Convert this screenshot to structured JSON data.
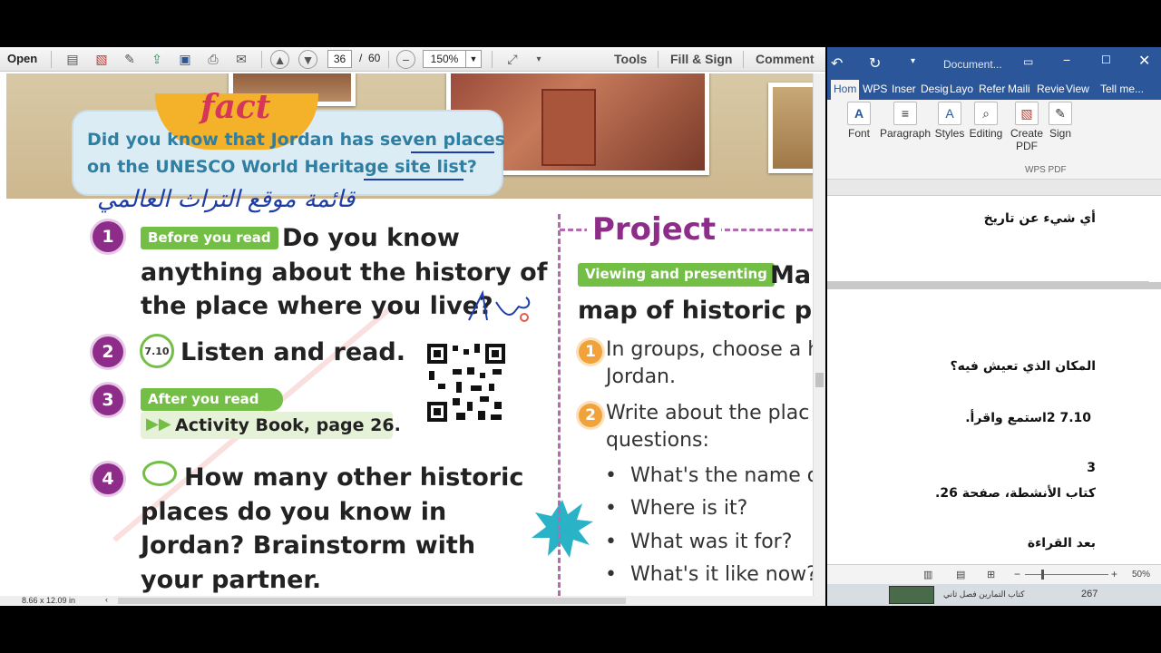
{
  "pdf_viewer": {
    "toolbar": {
      "open_label": "Open",
      "page_current": "36",
      "page_separator": "/",
      "page_total": "60",
      "zoom": "150%",
      "tools_label": "Tools",
      "fill_sign_label": "Fill & Sign",
      "comment_label": "Comment"
    },
    "status": {
      "page_size": "8.66 x 12.09 in"
    },
    "document": {
      "fact_badge": "fact",
      "fact_line1": "Did you know that Jordan has seven places",
      "fact_line2": "on the UNESCO World Heritage site list?",
      "handwriting_arabic": "قائمة موقع التراث العالمي",
      "items": [
        {
          "num": "1",
          "tag": "Before you read",
          "lines": [
            "Do you know",
            "anything about the history of",
            "the place where you live?"
          ]
        },
        {
          "num": "2",
          "audio_code": "7.10",
          "text": "Listen and read."
        },
        {
          "num": "3",
          "tag": "After you read",
          "sub": "Activity Book, page 26."
        },
        {
          "num": "4",
          "lines": [
            "How many other historic",
            "places do you know in",
            "Jordan? Brainstorm with",
            "your partner."
          ]
        }
      ],
      "project": {
        "title": "Project",
        "tag": "Viewing and presenting",
        "tag_after": "Ma",
        "subtitle": "map of historic pl",
        "steps": [
          {
            "num": "1",
            "lines": [
              "In groups, choose a h",
              "Jordan."
            ]
          },
          {
            "num": "2",
            "lines": [
              "Write about the plac",
              "questions:"
            ]
          }
        ],
        "bullets": [
          "What's the name o",
          "Where is it?",
          "What was it for?",
          "What's it like now?"
        ]
      }
    }
  },
  "word": {
    "title": "Document...",
    "tabs": [
      "Hom",
      "WPS",
      "Inser",
      "Desig",
      "Layo",
      "Refer",
      "Maili",
      "Revie",
      "View",
      "Tell me..."
    ],
    "ribbon": {
      "font": "Font",
      "paragraph": "Paragraph",
      "styles": "Styles",
      "editing": "Editing",
      "create_pdf": "Create PDF",
      "sign": "Sign",
      "group_label": "WPS PDF"
    },
    "page1_lines": [
      "أي شيء عن تاريخ"
    ],
    "page2_lines": [
      "المكان الذي تعيش فيه؟",
      "7.10 2استمع واقرأ.",
      "3",
      "كتاب الأنشطة، صفحة 26.",
      "بعد القراءة"
    ],
    "status": {
      "zoom": "50%"
    },
    "taskbar": {
      "item_text": "كتاب التمارين فصل ثاني",
      "count": "267"
    }
  }
}
